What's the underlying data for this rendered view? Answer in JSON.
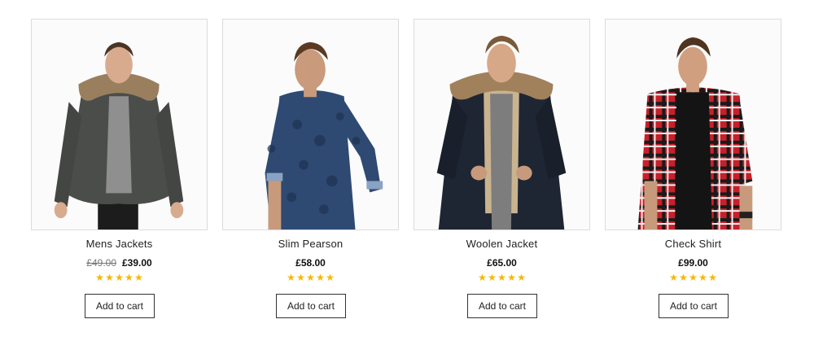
{
  "products": [
    {
      "name": "Mens Jackets",
      "old_price": "£49.00",
      "price": "£39.00",
      "rating": 5,
      "button": "Add to cart"
    },
    {
      "name": "Slim Pearson",
      "old_price": "",
      "price": "£58.00",
      "rating": 5,
      "button": "Add to cart"
    },
    {
      "name": "Woolen Jacket",
      "old_price": "",
      "price": "£65.00",
      "rating": 5,
      "button": "Add to cart"
    },
    {
      "name": "Check Shirt",
      "old_price": "",
      "price": "£99.00",
      "rating": 5,
      "button": "Add to cart"
    }
  ],
  "colors": {
    "star": "#f5b800",
    "border": "#dcdcdc"
  }
}
